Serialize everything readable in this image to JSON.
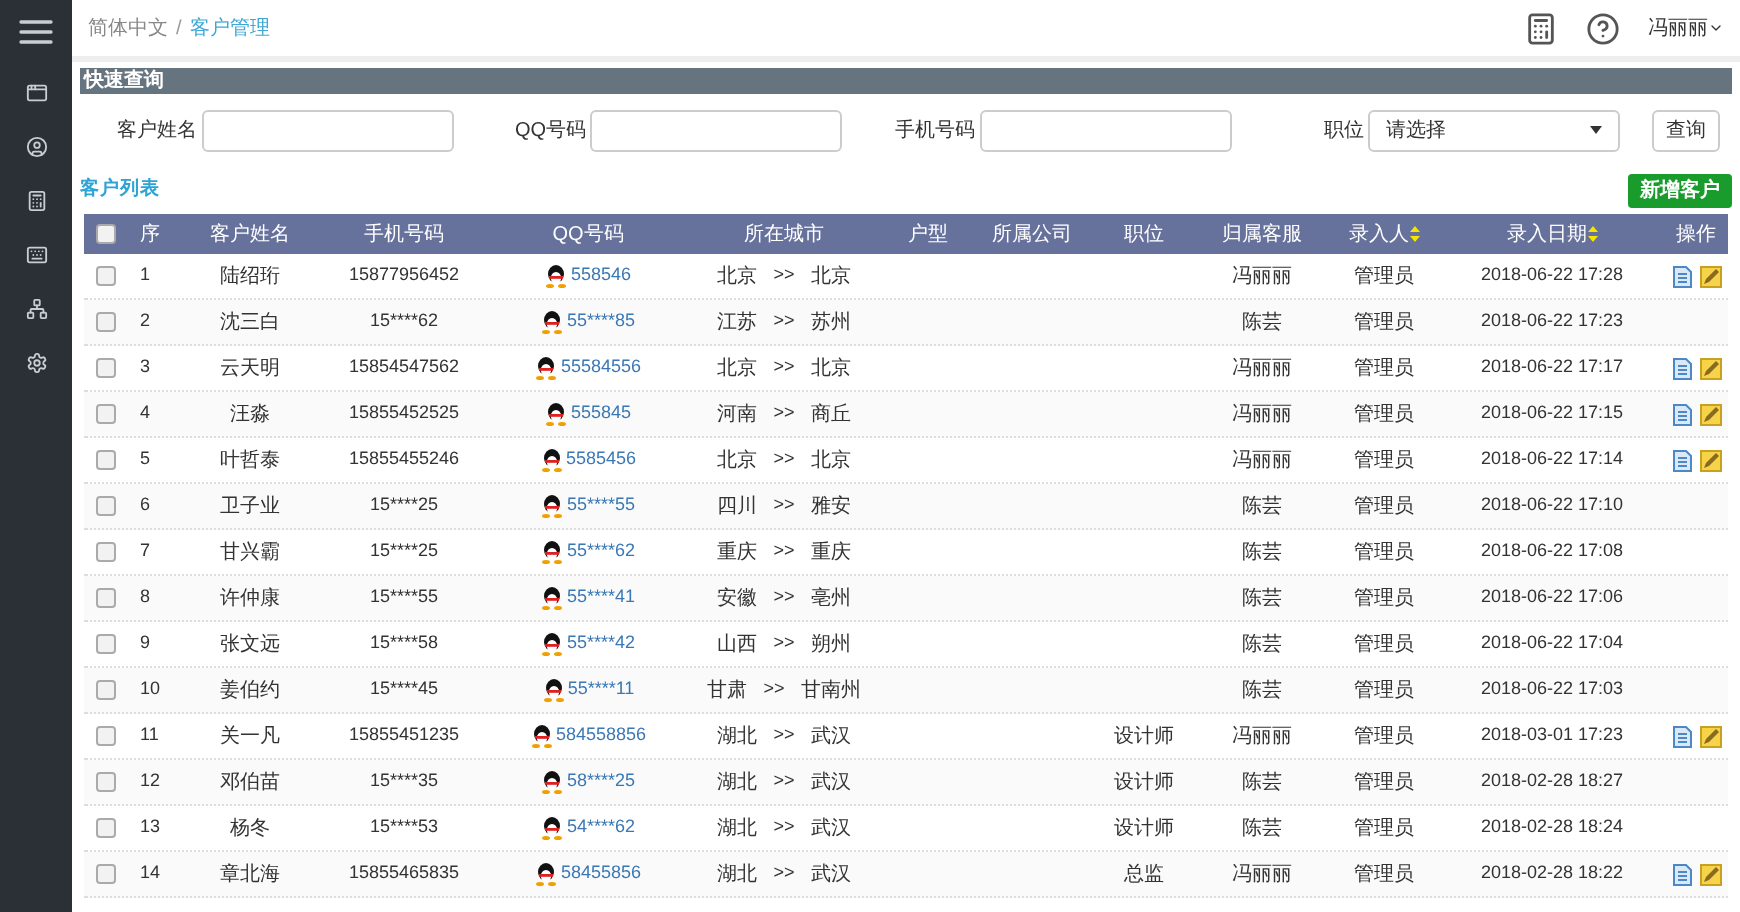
{
  "breadcrumb": [
    {
      "label": "简体中文",
      "selected": false
    },
    {
      "label": "客户管理",
      "selected": true
    }
  ],
  "breadcrumb_separator": "/",
  "user": {
    "name": "冯丽丽"
  },
  "quick_search": {
    "title": "快速查询",
    "fields": [
      {
        "label": "客户姓名",
        "kind": "text"
      },
      {
        "label": "QQ号码",
        "kind": "text"
      },
      {
        "label": "手机号码",
        "kind": "text"
      },
      {
        "label": "职位",
        "kind": "select",
        "value": "请选择"
      }
    ],
    "button": "查询"
  },
  "list": {
    "title": "客户列表",
    "add_button": "新增客户"
  },
  "table": {
    "header_checkbox": {
      "checked": false
    },
    "columns": [
      {
        "label": "序",
        "sortable": false
      },
      {
        "label": "客户姓名",
        "sortable": false
      },
      {
        "label": "手机号码",
        "sortable": false
      },
      {
        "label": "QQ号码",
        "sortable": false
      },
      {
        "label": "所在城市",
        "sortable": false
      },
      {
        "label": "户型",
        "sortable": false
      },
      {
        "label": "所属公司",
        "sortable": false
      },
      {
        "label": "职位",
        "sortable": false
      },
      {
        "label": "归属客服",
        "sortable": false
      },
      {
        "label": "录入人",
        "sortable": true
      },
      {
        "label": "录入日期",
        "sortable": true
      },
      {
        "label": "操作",
        "sortable": false
      }
    ],
    "rows": [
      {
        "checked": false,
        "seq": "1",
        "name": "陆绍珩",
        "phone": "15877956452",
        "qq": "558546",
        "province": "北京",
        "arrow": ">>",
        "city": "北京",
        "agent": "冯丽丽",
        "entered_by": "管理员",
        "date": "2018-06-22 17:28",
        "actions": true
      },
      {
        "checked": false,
        "seq": "2",
        "name": "沈三白",
        "phone": "15****62",
        "qq": "55****85",
        "province": "江苏",
        "arrow": ">>",
        "city": "苏州",
        "agent": "陈芸",
        "entered_by": "管理员",
        "date": "2018-06-22 17:23",
        "actions": false
      },
      {
        "checked": false,
        "seq": "3",
        "name": "云天明",
        "phone": "15854547562",
        "qq": "55584556",
        "province": "北京",
        "arrow": ">>",
        "city": "北京",
        "agent": "冯丽丽",
        "entered_by": "管理员",
        "date": "2018-06-22 17:17",
        "actions": true
      },
      {
        "checked": false,
        "seq": "4",
        "name": "汪淼",
        "phone": "15855452525",
        "qq": "555845",
        "province": "河南",
        "arrow": ">>",
        "city": "商丘",
        "agent": "冯丽丽",
        "entered_by": "管理员",
        "date": "2018-06-22 17:15",
        "actions": true
      },
      {
        "checked": false,
        "seq": "5",
        "name": "叶哲泰",
        "phone": "15855455246",
        "qq": "5585456",
        "province": "北京",
        "arrow": ">>",
        "city": "北京",
        "agent": "冯丽丽",
        "entered_by": "管理员",
        "date": "2018-06-22 17:14",
        "actions": true
      },
      {
        "checked": false,
        "seq": "6",
        "name": "卫子业",
        "phone": "15****25",
        "qq": "55****55",
        "province": "四川",
        "arrow": ">>",
        "city": "雅安",
        "agent": "陈芸",
        "entered_by": "管理员",
        "date": "2018-06-22 17:10",
        "actions": false
      },
      {
        "checked": false,
        "seq": "7",
        "name": "甘兴霸",
        "phone": "15****25",
        "qq": "55****62",
        "province": "重庆",
        "arrow": ">>",
        "city": "重庆",
        "agent": "陈芸",
        "entered_by": "管理员",
        "date": "2018-06-22 17:08",
        "actions": false
      },
      {
        "checked": false,
        "seq": "8",
        "name": "许仲康",
        "phone": "15****55",
        "qq": "55****41",
        "province": "安徽",
        "arrow": ">>",
        "city": "亳州",
        "agent": "陈芸",
        "entered_by": "管理员",
        "date": "2018-06-22 17:06",
        "actions": false
      },
      {
        "checked": false,
        "seq": "9",
        "name": "张文远",
        "phone": "15****58",
        "qq": "55****42",
        "province": "山西",
        "arrow": ">>",
        "city": "朔州",
        "agent": "陈芸",
        "entered_by": "管理员",
        "date": "2018-06-22 17:04",
        "actions": false
      },
      {
        "checked": false,
        "seq": "10",
        "name": "姜伯约",
        "phone": "15****45",
        "qq": "55****11",
        "province": "甘肃",
        "arrow": ">>",
        "city": "甘南州",
        "agent": "陈芸",
        "entered_by": "管理员",
        "date": "2018-06-22 17:03",
        "actions": false
      },
      {
        "checked": false,
        "seq": "11",
        "name": "关一凡",
        "phone": "15855451235",
        "qq": "584558856",
        "province": "湖北",
        "arrow": ">>",
        "city": "武汉",
        "position": "设计师",
        "agent": "冯丽丽",
        "entered_by": "管理员",
        "date": "2018-03-01 17:23",
        "actions": true
      },
      {
        "checked": false,
        "seq": "12",
        "name": "邓伯苗",
        "phone": "15****35",
        "qq": "58****25",
        "province": "湖北",
        "arrow": ">>",
        "city": "武汉",
        "position": "设计师",
        "agent": "陈芸",
        "entered_by": "管理员",
        "date": "2018-02-28 18:27",
        "actions": false
      },
      {
        "checked": false,
        "seq": "13",
        "name": "杨冬",
        "phone": "15****53",
        "qq": "54****62",
        "province": "湖北",
        "arrow": ">>",
        "city": "武汉",
        "position": "设计师",
        "agent": "陈芸",
        "entered_by": "管理员",
        "date": "2018-02-28 18:24",
        "actions": false
      },
      {
        "checked": false,
        "seq": "14",
        "name": "章北海",
        "phone": "15855465835",
        "qq": "58455856",
        "province": "湖北",
        "arrow": ">>",
        "city": "武汉",
        "position": "总监",
        "agent": "冯丽丽",
        "entered_by": "管理员",
        "date": "2018-02-28 18:22",
        "actions": true
      }
    ]
  }
}
